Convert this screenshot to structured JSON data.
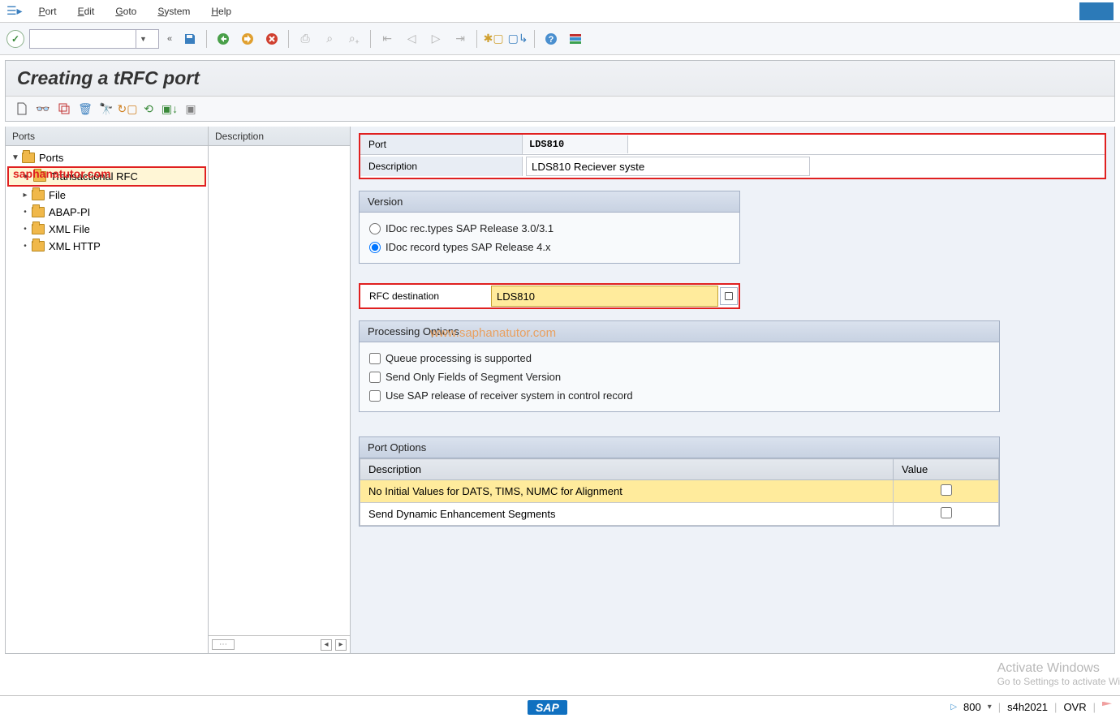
{
  "menu": {
    "items": [
      "Port",
      "Edit",
      "Goto",
      "System",
      "Help"
    ]
  },
  "toolbar": {
    "command_value": ""
  },
  "page": {
    "title": "Creating a tRFC port"
  },
  "tree": {
    "header_ports": "Ports",
    "header_desc": "Description",
    "root": "Ports",
    "items": [
      {
        "label": "Transactional RFC",
        "expandable": true,
        "highlighted": true
      },
      {
        "label": "File",
        "expandable": true
      },
      {
        "label": "ABAP-PI",
        "expandable": false
      },
      {
        "label": "XML File",
        "expandable": false
      },
      {
        "label": "XML HTTP",
        "expandable": false
      }
    ]
  },
  "form": {
    "port_label": "Port",
    "port_value": "LDS810",
    "desc_label": "Description",
    "desc_value": "LDS810 Reciever syste"
  },
  "version": {
    "title": "Version",
    "opt1": "IDoc rec.types SAP Release 3.0/3.1",
    "opt2": "IDoc record types SAP Release 4.x"
  },
  "rfc": {
    "label": "RFC destination",
    "value": "LDS810"
  },
  "processing": {
    "title": "Processing Options",
    "opt1": "Queue processing is supported",
    "opt2": "Send Only Fields of Segment Version",
    "opt3": "Use SAP release of receiver system in control record"
  },
  "port_options": {
    "title": "Port Options",
    "col_desc": "Description",
    "col_val": "Value",
    "rows": [
      {
        "desc": "No Initial Values for DATS, TIMS, NUMC for Alignment",
        "selected": true
      },
      {
        "desc": "Send Dynamic Enhancement Segments",
        "selected": false
      }
    ]
  },
  "annotations": {
    "brand1": "saphanatutor.com",
    "brand2": "www.saphanatutor.com"
  },
  "activate": {
    "line1": "Activate Windows",
    "line2": "Go to Settings to activate Wi"
  },
  "status": {
    "sap": "SAP",
    "client": "800",
    "system": "s4h2021",
    "mode": "OVR"
  }
}
